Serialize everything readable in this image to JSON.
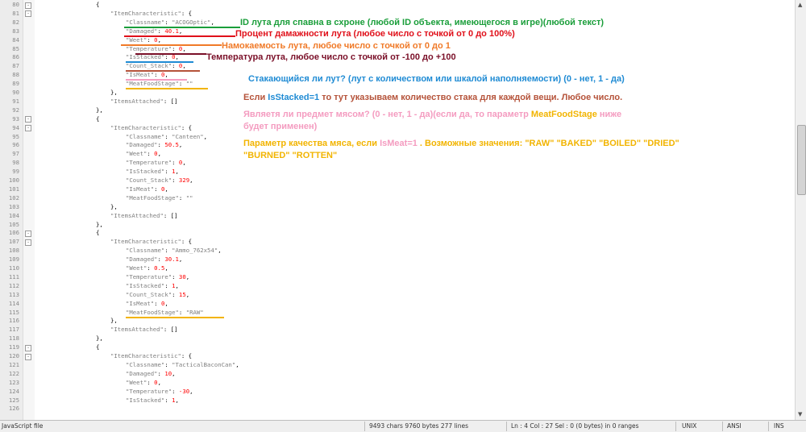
{
  "lines": [
    {
      "n": "80",
      "fold": "-",
      "indent": 1,
      "parts": [
        [
          "t",
          "{"
        ]
      ]
    },
    {
      "n": "81",
      "fold": "-",
      "indent": 2,
      "parts": [
        [
          "s",
          "\"ItemCharacteristic\""
        ],
        [
          "t",
          ": {"
        ]
      ]
    },
    {
      "n": "82",
      "indent": 3,
      "parts": [
        [
          "s",
          "\"Classname\""
        ],
        [
          "t",
          ": "
        ],
        [
          "s",
          "\"ACOGOptic\""
        ],
        [
          "t",
          ","
        ]
      ]
    },
    {
      "n": "83",
      "indent": 3,
      "parts": [
        [
          "s",
          "\"Damaged\""
        ],
        [
          "t",
          ": "
        ],
        [
          "n",
          "40.1"
        ],
        [
          "t",
          ","
        ]
      ]
    },
    {
      "n": "84",
      "indent": 3,
      "parts": [
        [
          "s",
          "\"Weet\""
        ],
        [
          "t",
          ": "
        ],
        [
          "n",
          "0"
        ],
        [
          "t",
          ","
        ]
      ]
    },
    {
      "n": "85",
      "indent": 3,
      "parts": [
        [
          "s",
          "\"Temperature\""
        ],
        [
          "t",
          ": "
        ],
        [
          "n",
          "0"
        ],
        [
          "t",
          ","
        ]
      ]
    },
    {
      "n": "86",
      "indent": 3,
      "parts": [
        [
          "s",
          "\"IsStacked\""
        ],
        [
          "t",
          ": "
        ],
        [
          "n",
          "0"
        ],
        [
          "t",
          ","
        ]
      ]
    },
    {
      "n": "87",
      "indent": 3,
      "parts": [
        [
          "s",
          "\"Count_Stack\""
        ],
        [
          "t",
          ": "
        ],
        [
          "n",
          "0"
        ],
        [
          "t",
          ","
        ]
      ]
    },
    {
      "n": "88",
      "indent": 3,
      "parts": [
        [
          "s",
          "\"IsMeat\""
        ],
        [
          "t",
          ": "
        ],
        [
          "n",
          "0"
        ],
        [
          "t",
          ","
        ]
      ]
    },
    {
      "n": "89",
      "indent": 3,
      "parts": [
        [
          "s",
          "\"MeatFoodStage\""
        ],
        [
          "t",
          ": "
        ],
        [
          "s",
          "\"\""
        ]
      ]
    },
    {
      "n": "90",
      "indent": 2,
      "parts": [
        [
          "t",
          "},"
        ]
      ]
    },
    {
      "n": "91",
      "indent": 2,
      "parts": [
        [
          "s",
          "\"ItemsAttached\""
        ],
        [
          "t",
          ": []"
        ]
      ]
    },
    {
      "n": "92",
      "indent": 1,
      "parts": [
        [
          "t",
          "},"
        ]
      ]
    },
    {
      "n": "93",
      "fold": "-",
      "indent": 1,
      "parts": [
        [
          "t",
          "{"
        ]
      ]
    },
    {
      "n": "94",
      "fold": "-",
      "indent": 2,
      "parts": [
        [
          "s",
          "\"ItemCharacteristic\""
        ],
        [
          "t",
          ": {"
        ]
      ]
    },
    {
      "n": "95",
      "indent": 3,
      "parts": [
        [
          "s",
          "\"Classname\""
        ],
        [
          "t",
          ": "
        ],
        [
          "s",
          "\"Canteen\""
        ],
        [
          "t",
          ","
        ]
      ]
    },
    {
      "n": "96",
      "indent": 3,
      "parts": [
        [
          "s",
          "\"Damaged\""
        ],
        [
          "t",
          ": "
        ],
        [
          "n",
          "50.5"
        ],
        [
          "t",
          ","
        ]
      ]
    },
    {
      "n": "97",
      "indent": 3,
      "parts": [
        [
          "s",
          "\"Weet\""
        ],
        [
          "t",
          ": "
        ],
        [
          "n",
          "0"
        ],
        [
          "t",
          ","
        ]
      ]
    },
    {
      "n": "98",
      "indent": 3,
      "parts": [
        [
          "s",
          "\"Temperature\""
        ],
        [
          "t",
          ": "
        ],
        [
          "n",
          "0"
        ],
        [
          "t",
          ","
        ]
      ]
    },
    {
      "n": "99",
      "indent": 3,
      "parts": [
        [
          "s",
          "\"IsStacked\""
        ],
        [
          "t",
          ": "
        ],
        [
          "n",
          "1"
        ],
        [
          "t",
          ","
        ]
      ]
    },
    {
      "n": "100",
      "indent": 3,
      "parts": [
        [
          "s",
          "\"Count_Stack\""
        ],
        [
          "t",
          ": "
        ],
        [
          "n",
          "329"
        ],
        [
          "t",
          ","
        ]
      ]
    },
    {
      "n": "101",
      "indent": 3,
      "parts": [
        [
          "s",
          "\"IsMeat\""
        ],
        [
          "t",
          ": "
        ],
        [
          "n",
          "0"
        ],
        [
          "t",
          ","
        ]
      ]
    },
    {
      "n": "102",
      "indent": 3,
      "parts": [
        [
          "s",
          "\"MeatFoodStage\""
        ],
        [
          "t",
          ": "
        ],
        [
          "s",
          "\"\""
        ]
      ]
    },
    {
      "n": "103",
      "indent": 2,
      "parts": [
        [
          "t",
          "},"
        ]
      ]
    },
    {
      "n": "104",
      "indent": 2,
      "parts": [
        [
          "s",
          "\"ItemsAttached\""
        ],
        [
          "t",
          ": []"
        ]
      ]
    },
    {
      "n": "105",
      "indent": 1,
      "parts": [
        [
          "t",
          "},"
        ]
      ]
    },
    {
      "n": "106",
      "fold": "-",
      "indent": 1,
      "parts": [
        [
          "t",
          "{"
        ]
      ]
    },
    {
      "n": "107",
      "fold": "-",
      "indent": 2,
      "parts": [
        [
          "s",
          "\"ItemCharacteristic\""
        ],
        [
          "t",
          ": {"
        ]
      ]
    },
    {
      "n": "108",
      "indent": 3,
      "parts": [
        [
          "s",
          "\"Classname\""
        ],
        [
          "t",
          ": "
        ],
        [
          "s",
          "\"Ammo_762x54\""
        ],
        [
          "t",
          ","
        ]
      ]
    },
    {
      "n": "109",
      "indent": 3,
      "parts": [
        [
          "s",
          "\"Damaged\""
        ],
        [
          "t",
          ": "
        ],
        [
          "n",
          "30.1"
        ],
        [
          "t",
          ","
        ]
      ]
    },
    {
      "n": "110",
      "indent": 3,
      "parts": [
        [
          "s",
          "\"Weet\""
        ],
        [
          "t",
          ": "
        ],
        [
          "n",
          "0.5"
        ],
        [
          "t",
          ","
        ]
      ]
    },
    {
      "n": "111",
      "indent": 3,
      "parts": [
        [
          "s",
          "\"Temperature\""
        ],
        [
          "t",
          ": "
        ],
        [
          "n",
          "30"
        ],
        [
          "t",
          ","
        ]
      ]
    },
    {
      "n": "112",
      "indent": 3,
      "parts": [
        [
          "s",
          "\"IsStacked\""
        ],
        [
          "t",
          ": "
        ],
        [
          "n",
          "1"
        ],
        [
          "t",
          ","
        ]
      ]
    },
    {
      "n": "113",
      "indent": 3,
      "parts": [
        [
          "s",
          "\"Count_Stack\""
        ],
        [
          "t",
          ": "
        ],
        [
          "n",
          "15"
        ],
        [
          "t",
          ","
        ]
      ]
    },
    {
      "n": "114",
      "indent": 3,
      "parts": [
        [
          "s",
          "\"IsMeat\""
        ],
        [
          "t",
          ": "
        ],
        [
          "n",
          "0"
        ],
        [
          "t",
          ","
        ]
      ]
    },
    {
      "n": "115",
      "indent": 3,
      "parts": [
        [
          "s",
          "\"MeatFoodStage\""
        ],
        [
          "t",
          ": "
        ],
        [
          "s",
          "\"RAW\""
        ]
      ]
    },
    {
      "n": "116",
      "indent": 2,
      "parts": [
        [
          "t",
          "},"
        ]
      ]
    },
    {
      "n": "117",
      "indent": 2,
      "parts": [
        [
          "s",
          "\"ItemsAttached\""
        ],
        [
          "t",
          ": []"
        ]
      ]
    },
    {
      "n": "118",
      "indent": 1,
      "parts": [
        [
          "t",
          "},"
        ]
      ]
    },
    {
      "n": "119",
      "fold": "-",
      "indent": 1,
      "parts": [
        [
          "t",
          "{"
        ]
      ]
    },
    {
      "n": "120",
      "fold": "-",
      "indent": 2,
      "parts": [
        [
          "s",
          "\"ItemCharacteristic\""
        ],
        [
          "t",
          ": {"
        ]
      ]
    },
    {
      "n": "121",
      "indent": 3,
      "parts": [
        [
          "s",
          "\"Classname\""
        ],
        [
          "t",
          ": "
        ],
        [
          "s",
          "\"TacticalBaconCan\""
        ],
        [
          "t",
          ","
        ]
      ]
    },
    {
      "n": "122",
      "indent": 3,
      "parts": [
        [
          "s",
          "\"Damaged\""
        ],
        [
          "t",
          ": "
        ],
        [
          "n",
          "10"
        ],
        [
          "t",
          ","
        ]
      ]
    },
    {
      "n": "123",
      "indent": 3,
      "parts": [
        [
          "s",
          "\"Weet\""
        ],
        [
          "t",
          ": "
        ],
        [
          "n",
          "0"
        ],
        [
          "t",
          ","
        ]
      ]
    },
    {
      "n": "124",
      "indent": 3,
      "parts": [
        [
          "s",
          "\"Temperature\""
        ],
        [
          "t",
          ": "
        ],
        [
          "n",
          "-30"
        ],
        [
          "t",
          ","
        ]
      ]
    },
    {
      "n": "125",
      "indent": 3,
      "parts": [
        [
          "s",
          "\"IsStacked\""
        ],
        [
          "t",
          ": "
        ],
        [
          "n",
          "1"
        ],
        [
          "t",
          ","
        ]
      ]
    },
    {
      "n": "126",
      "indent": 3,
      "parts": [
        [
          "t",
          ""
        ]
      ]
    }
  ],
  "annotations": [
    {
      "id": "classname",
      "color": "#1a9e3a",
      "text": "ID лута для спавна в схроне (любой ID объекта, имеющегося в игре)(любой текст)"
    },
    {
      "id": "damaged",
      "color": "#e0101a",
      "text": "Процент дамажности лута (любое число с точкой от 0 до 100%)"
    },
    {
      "id": "weet",
      "color": "#f07a28",
      "text": "Намокаемость лута, любое число с точкой от 0 до 1"
    },
    {
      "id": "temperature",
      "color": "#7a0f28",
      "text": "Температура лута, любое число с точкой от -100 до +100"
    },
    {
      "id": "isstacked",
      "color": "#1f8bd4",
      "text": "Стакающийся ли лут? (лут с количеством или шкалой наполняемости) (0 - нет, 1 - да)"
    },
    {
      "id": "count_stack",
      "color": "#b5533a",
      "prefix": "Если ",
      "accent": "IsStacked=1",
      "accent_color": "#1f8bd4",
      "suffix": " то тут указываем количество стака для каждой вещи. Любое число."
    },
    {
      "id": "ismeat",
      "color": "#f49cc0",
      "line1_prefix": "Являетя ли предмет мясом? (0 - нет, 1 - да)(если да, то параметр ",
      "line1_accent": "MeatFoodStage",
      "line1_accent_color": "#f2b400",
      "line1_suffix": " ниже",
      "line2": "будет применен)"
    },
    {
      "id": "meatfoodstage",
      "color": "#f2b400",
      "line1_prefix": "Параметр качества мяса, если ",
      "line1_accent": "IsMeat=1",
      "line1_accent_color": "#f49cc0",
      "line1_suffix": " . Возможные значения: \"RAW\" \"BAKED\" \"BOILED\" \"DRIED\"",
      "line2": "\"BURNED\" \"ROTTEN\""
    }
  ],
  "status": {
    "filetype": "JavaScript file",
    "stats": "9493 chars   9760 bytes   277 lines",
    "position": "Ln : 4    Col : 27    Sel : 0 (0 bytes) in 0 ranges",
    "eol": "UNIX",
    "encoding": "ANSI",
    "mode": "INS"
  },
  "colors": {
    "string": "#808080",
    "number": "#ff0000",
    "gutter": "#ececec"
  }
}
